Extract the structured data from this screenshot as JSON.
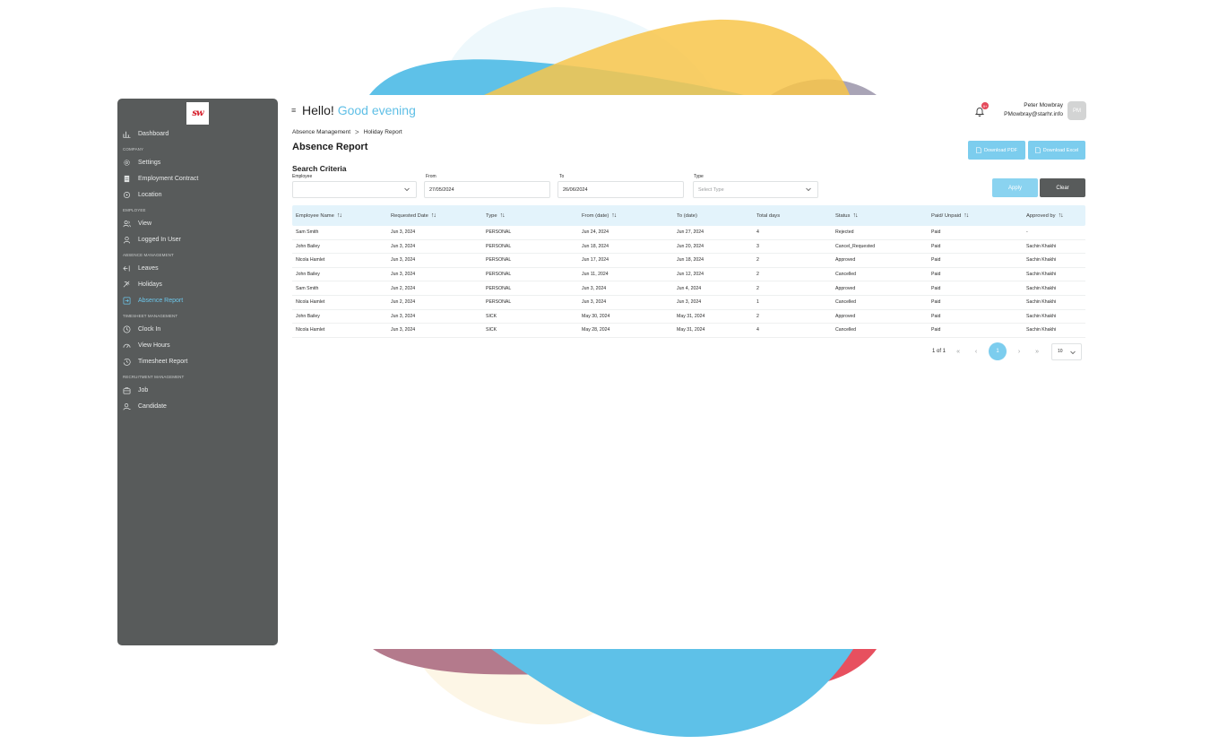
{
  "colors": {
    "accent": "#5fbfe6",
    "sidebar": "#585b5b",
    "button": "#7ccdee",
    "clear": "#585b5b",
    "badge": "#e44a5b"
  },
  "sidebar": {
    "logo": "sw",
    "items": [
      {
        "label": "Dashboard",
        "icon": "bar-chart-icon"
      },
      {
        "section": "COMPANY"
      },
      {
        "label": "Settings",
        "icon": "gear-icon"
      },
      {
        "label": "Employment Contract",
        "icon": "document-icon"
      },
      {
        "label": "Location",
        "icon": "location-icon"
      },
      {
        "section": "EMPLOYEE"
      },
      {
        "label": "View",
        "icon": "users-icon"
      },
      {
        "label": "Logged In User",
        "icon": "user-icon"
      },
      {
        "section": "ABSENCE MANAGEMENT"
      },
      {
        "label": "Leaves",
        "icon": "leave-icon"
      },
      {
        "label": "Holidays",
        "icon": "beach-icon"
      },
      {
        "label": "Absence Report",
        "icon": "report-icon",
        "active": true
      },
      {
        "section": "TIMESHEET MANAGEMENT"
      },
      {
        "label": "Clock In",
        "icon": "clock-icon"
      },
      {
        "label": "View Hours",
        "icon": "gauge-icon"
      },
      {
        "label": "Timesheet Report",
        "icon": "history-icon"
      },
      {
        "section": "RECRUITMENT MANAGEMENT"
      },
      {
        "label": "Job",
        "icon": "briefcase-icon"
      },
      {
        "label": "Candidate",
        "icon": "candidate-icon"
      }
    ]
  },
  "header": {
    "menu_icon": "≡",
    "greet_hello": "Hello!",
    "greet_time": "Good evening",
    "notification_count": "9+",
    "user_name": "Peter Mowbray",
    "user_email": "PMowbray@starhr.info",
    "avatar_initials": "PM"
  },
  "breadcrumb": {
    "parent": "Absence Management",
    "sep": ">",
    "current": "Holiday Report"
  },
  "page": {
    "title": "Absence Report",
    "download_pdf": "Download PDF",
    "download_excel": "Download Excel"
  },
  "criteria": {
    "title": "Search Criteria",
    "employee_label": "Employee",
    "employee_value": "",
    "from_label": "From",
    "from_value": "27/05/2024",
    "to_label": "To",
    "to_value": "26/06/2024",
    "type_label": "Type",
    "type_placeholder": "Select Type",
    "apply": "Apply",
    "clear": "Clear"
  },
  "table": {
    "columns": [
      "Employee Name",
      "Requested Date",
      "Type",
      "From (date)",
      "To (date)",
      "Total days",
      "Status",
      "Paid/ Unpaid",
      "Approved by"
    ],
    "sortable": [
      true,
      true,
      true,
      true,
      false,
      false,
      true,
      true,
      true
    ],
    "rows": [
      [
        "Sam Smith",
        "Jun 3, 2024",
        "PERSONAL",
        "Jun 24, 2024",
        "Jun 27, 2024",
        "4",
        "Rejected",
        "Paid",
        "-"
      ],
      [
        "John Bailey",
        "Jun 3, 2024",
        "PERSONAL",
        "Jun 18, 2024",
        "Jun 20, 2024",
        "3",
        "Cancel_Requested",
        "Paid",
        "Sachin Khakhi"
      ],
      [
        "Nicola Hamlet",
        "Jun 3, 2024",
        "PERSONAL",
        "Jun 17, 2024",
        "Jun 18, 2024",
        "2",
        "Approved",
        "Paid",
        "Sachin Khakhi"
      ],
      [
        "John Bailey",
        "Jun 3, 2024",
        "PERSONAL",
        "Jun 11, 2024",
        "Jun 12, 2024",
        "2",
        "Cancelled",
        "Paid",
        "Sachin Khakhi"
      ],
      [
        "Sam Smith",
        "Jun 2, 2024",
        "PERSONAL",
        "Jun 3, 2024",
        "Jun 4, 2024",
        "2",
        "Approved",
        "Paid",
        "Sachin Khakhi"
      ],
      [
        "Nicola Hamlet",
        "Jun 2, 2024",
        "PERSONAL",
        "Jun 3, 2024",
        "Jun 3, 2024",
        "1",
        "Cancelled",
        "Paid",
        "Sachin Khakhi"
      ],
      [
        "John Bailey",
        "Jun 3, 2024",
        "SICK",
        "May 30, 2024",
        "May 31, 2024",
        "2",
        "Approved",
        "Paid",
        "Sachin Khakhi"
      ],
      [
        "Nicola Hamlet",
        "Jun 3, 2024",
        "SICK",
        "May 28, 2024",
        "May 31, 2024",
        "4",
        "Cancelled",
        "Paid",
        "Sachin Khakhi"
      ]
    ]
  },
  "pagination": {
    "info": "1 of 1",
    "first": "«",
    "prev": "‹",
    "current": "1",
    "next": "›",
    "last": "»",
    "page_size": "10"
  }
}
